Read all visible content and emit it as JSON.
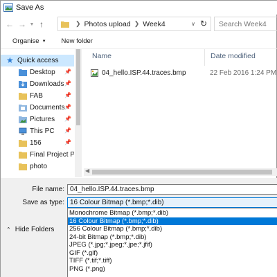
{
  "window": {
    "title": "Save As"
  },
  "address": {
    "crumbs": [
      "Photos upload",
      "Week4"
    ],
    "search_placeholder": "Search Week4"
  },
  "toolbar": {
    "organise": "Organise",
    "new_folder": "New folder"
  },
  "nav": {
    "items": [
      {
        "label": "Quick access",
        "icon": "star-icon",
        "pinned": false,
        "selected": true
      },
      {
        "label": "Desktop",
        "icon": "desktop-folder-icon",
        "pinned": true
      },
      {
        "label": "Downloads",
        "icon": "downloads-folder-icon",
        "pinned": true
      },
      {
        "label": "FAB",
        "icon": "folder-icon",
        "pinned": true
      },
      {
        "label": "Documents",
        "icon": "documents-folder-icon",
        "pinned": true
      },
      {
        "label": "Pictures",
        "icon": "pictures-folder-icon",
        "pinned": true
      },
      {
        "label": "This PC",
        "icon": "computer-icon",
        "pinned": true
      },
      {
        "label": "156",
        "icon": "folder-icon",
        "pinned": true
      },
      {
        "label": "Final Project Pa",
        "icon": "folder-icon",
        "pinned": false
      },
      {
        "label": "photo",
        "icon": "folder-icon",
        "pinned": false
      }
    ]
  },
  "files": {
    "col_name": "Name",
    "col_date": "Date modified",
    "rows": [
      {
        "name": "04_hello.ISP.44.traces.bmp",
        "date": "22 Feb 2016 1:24 PM"
      }
    ]
  },
  "save": {
    "file_name_label": "File name:",
    "file_name_value": "04_hello.ISP.44.traces.bmp",
    "save_as_type_label": "Save as type:",
    "save_as_type_value": "16 Colour Bitmap (*.bmp;*.dib)",
    "type_options": [
      "Monochrome Bitmap (*.bmp;*.dib)",
      "16 Colour Bitmap (*.bmp;*.dib)",
      "256 Colour Bitmap (*.bmp;*.dib)",
      "24-bit Bitmap (*.bmp;*.dib)",
      "JPEG (*.jpg;*.jpeg;*.jpe;*.jfif)",
      "GIF (*.gif)",
      "TIFF (*.tif;*.tiff)",
      "PNG (*.png)"
    ],
    "highlighted_index": 1,
    "hide_folders": "Hide Folders"
  },
  "colors": {
    "accent": "#0078d7",
    "selected_bg": "#cce8ff",
    "folder": "#e8c25a"
  }
}
